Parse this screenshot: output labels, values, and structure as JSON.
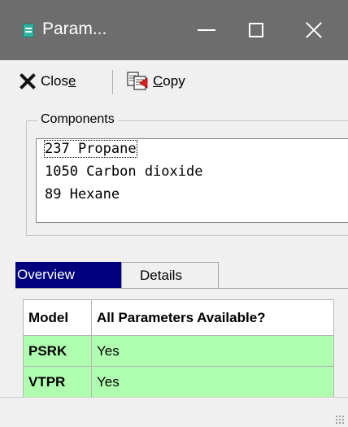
{
  "window": {
    "title": "Param...",
    "icon": "database-icon"
  },
  "toolbar": {
    "close_label": "Close",
    "close_icon": "close-x-icon",
    "copy_label": "Copy",
    "copy_icon": "copy-icon"
  },
  "components": {
    "legend": "Components",
    "items": [
      "237 Propane",
      "1050 Carbon dioxide",
      "89 Hexane"
    ]
  },
  "tabs": {
    "overview": "Overview",
    "details": "Details",
    "active": "Overview"
  },
  "grid": {
    "headers": [
      "Model",
      "All Parameters Available?"
    ],
    "rows": [
      [
        "PSRK",
        "Yes"
      ],
      [
        "VTPR",
        "Yes"
      ]
    ],
    "row_color": "#b0ffb0"
  },
  "colors": {
    "titlebar": "#6d6d6d",
    "active_tab": "#00007f"
  }
}
